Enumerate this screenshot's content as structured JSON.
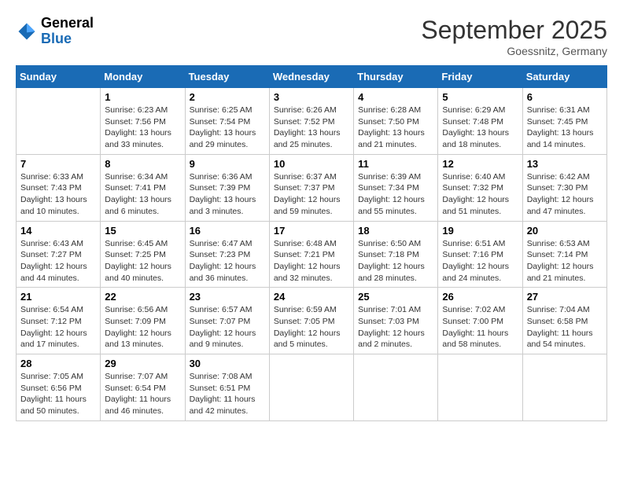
{
  "header": {
    "logo_general": "General",
    "logo_blue": "Blue",
    "month_title": "September 2025",
    "location": "Goessnitz, Germany"
  },
  "days_of_week": [
    "Sunday",
    "Monday",
    "Tuesday",
    "Wednesday",
    "Thursday",
    "Friday",
    "Saturday"
  ],
  "weeks": [
    [
      {
        "day": "",
        "content": ""
      },
      {
        "day": "1",
        "content": "Sunrise: 6:23 AM\nSunset: 7:56 PM\nDaylight: 13 hours and 33 minutes."
      },
      {
        "day": "2",
        "content": "Sunrise: 6:25 AM\nSunset: 7:54 PM\nDaylight: 13 hours and 29 minutes."
      },
      {
        "day": "3",
        "content": "Sunrise: 6:26 AM\nSunset: 7:52 PM\nDaylight: 13 hours and 25 minutes."
      },
      {
        "day": "4",
        "content": "Sunrise: 6:28 AM\nSunset: 7:50 PM\nDaylight: 13 hours and 21 minutes."
      },
      {
        "day": "5",
        "content": "Sunrise: 6:29 AM\nSunset: 7:48 PM\nDaylight: 13 hours and 18 minutes."
      },
      {
        "day": "6",
        "content": "Sunrise: 6:31 AM\nSunset: 7:45 PM\nDaylight: 13 hours and 14 minutes."
      }
    ],
    [
      {
        "day": "7",
        "content": "Sunrise: 6:33 AM\nSunset: 7:43 PM\nDaylight: 13 hours and 10 minutes."
      },
      {
        "day": "8",
        "content": "Sunrise: 6:34 AM\nSunset: 7:41 PM\nDaylight: 13 hours and 6 minutes."
      },
      {
        "day": "9",
        "content": "Sunrise: 6:36 AM\nSunset: 7:39 PM\nDaylight: 13 hours and 3 minutes."
      },
      {
        "day": "10",
        "content": "Sunrise: 6:37 AM\nSunset: 7:37 PM\nDaylight: 12 hours and 59 minutes."
      },
      {
        "day": "11",
        "content": "Sunrise: 6:39 AM\nSunset: 7:34 PM\nDaylight: 12 hours and 55 minutes."
      },
      {
        "day": "12",
        "content": "Sunrise: 6:40 AM\nSunset: 7:32 PM\nDaylight: 12 hours and 51 minutes."
      },
      {
        "day": "13",
        "content": "Sunrise: 6:42 AM\nSunset: 7:30 PM\nDaylight: 12 hours and 47 minutes."
      }
    ],
    [
      {
        "day": "14",
        "content": "Sunrise: 6:43 AM\nSunset: 7:27 PM\nDaylight: 12 hours and 44 minutes."
      },
      {
        "day": "15",
        "content": "Sunrise: 6:45 AM\nSunset: 7:25 PM\nDaylight: 12 hours and 40 minutes."
      },
      {
        "day": "16",
        "content": "Sunrise: 6:47 AM\nSunset: 7:23 PM\nDaylight: 12 hours and 36 minutes."
      },
      {
        "day": "17",
        "content": "Sunrise: 6:48 AM\nSunset: 7:21 PM\nDaylight: 12 hours and 32 minutes."
      },
      {
        "day": "18",
        "content": "Sunrise: 6:50 AM\nSunset: 7:18 PM\nDaylight: 12 hours and 28 minutes."
      },
      {
        "day": "19",
        "content": "Sunrise: 6:51 AM\nSunset: 7:16 PM\nDaylight: 12 hours and 24 minutes."
      },
      {
        "day": "20",
        "content": "Sunrise: 6:53 AM\nSunset: 7:14 PM\nDaylight: 12 hours and 21 minutes."
      }
    ],
    [
      {
        "day": "21",
        "content": "Sunrise: 6:54 AM\nSunset: 7:12 PM\nDaylight: 12 hours and 17 minutes."
      },
      {
        "day": "22",
        "content": "Sunrise: 6:56 AM\nSunset: 7:09 PM\nDaylight: 12 hours and 13 minutes."
      },
      {
        "day": "23",
        "content": "Sunrise: 6:57 AM\nSunset: 7:07 PM\nDaylight: 12 hours and 9 minutes."
      },
      {
        "day": "24",
        "content": "Sunrise: 6:59 AM\nSunset: 7:05 PM\nDaylight: 12 hours and 5 minutes."
      },
      {
        "day": "25",
        "content": "Sunrise: 7:01 AM\nSunset: 7:03 PM\nDaylight: 12 hours and 2 minutes."
      },
      {
        "day": "26",
        "content": "Sunrise: 7:02 AM\nSunset: 7:00 PM\nDaylight: 11 hours and 58 minutes."
      },
      {
        "day": "27",
        "content": "Sunrise: 7:04 AM\nSunset: 6:58 PM\nDaylight: 11 hours and 54 minutes."
      }
    ],
    [
      {
        "day": "28",
        "content": "Sunrise: 7:05 AM\nSunset: 6:56 PM\nDaylight: 11 hours and 50 minutes."
      },
      {
        "day": "29",
        "content": "Sunrise: 7:07 AM\nSunset: 6:54 PM\nDaylight: 11 hours and 46 minutes."
      },
      {
        "day": "30",
        "content": "Sunrise: 7:08 AM\nSunset: 6:51 PM\nDaylight: 11 hours and 42 minutes."
      },
      {
        "day": "",
        "content": ""
      },
      {
        "day": "",
        "content": ""
      },
      {
        "day": "",
        "content": ""
      },
      {
        "day": "",
        "content": ""
      }
    ]
  ]
}
